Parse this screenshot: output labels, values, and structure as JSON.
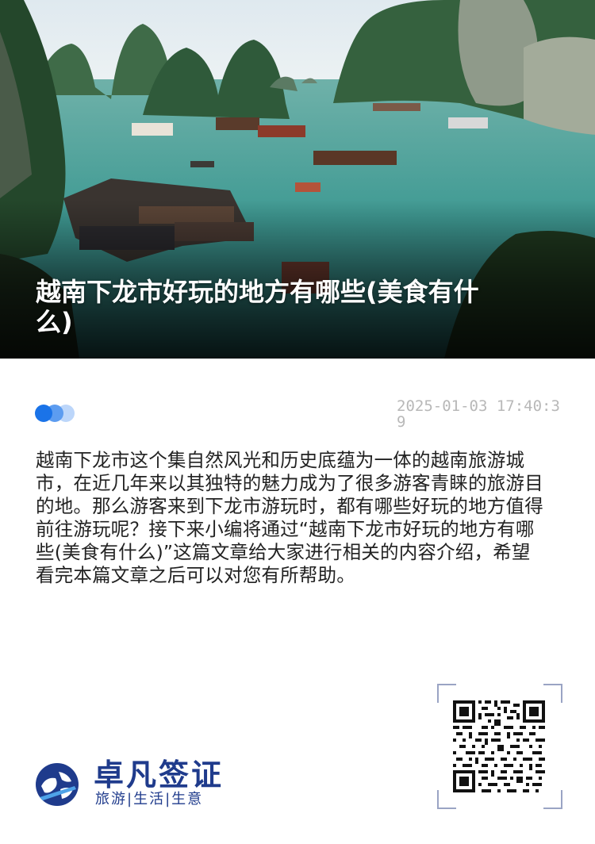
{
  "hero": {
    "title": "越南下龙市好玩的地方有哪些(美食有什么)"
  },
  "meta": {
    "timestamp": "2025-01-03 17:40:39"
  },
  "article": {
    "body": "越南下龙市这个集自然风光和历史底蕴为一体的越南旅游城市，在近几年来以其独特的魅力成为了很多游客青睐的旅游目的地。那么游客来到下龙市游玩时，都有哪些好玩的地方值得前往游玩呢？接下来小编将通过“越南下龙市好玩的地方有哪些(美食有什么)”这篇文章给大家进行相关的内容介绍，希望看完本篇文章之后可以对您有所帮助。"
  },
  "brand": {
    "name": "卓凡签证",
    "tagline": "旅游|生活|生意"
  },
  "colors": {
    "accent": "#1a73e8",
    "brand": "#1f3b8c",
    "timestamp": "#b8b8b8"
  },
  "icons": {
    "logo": "globe-airplane-logo",
    "qr": "qr-code"
  }
}
